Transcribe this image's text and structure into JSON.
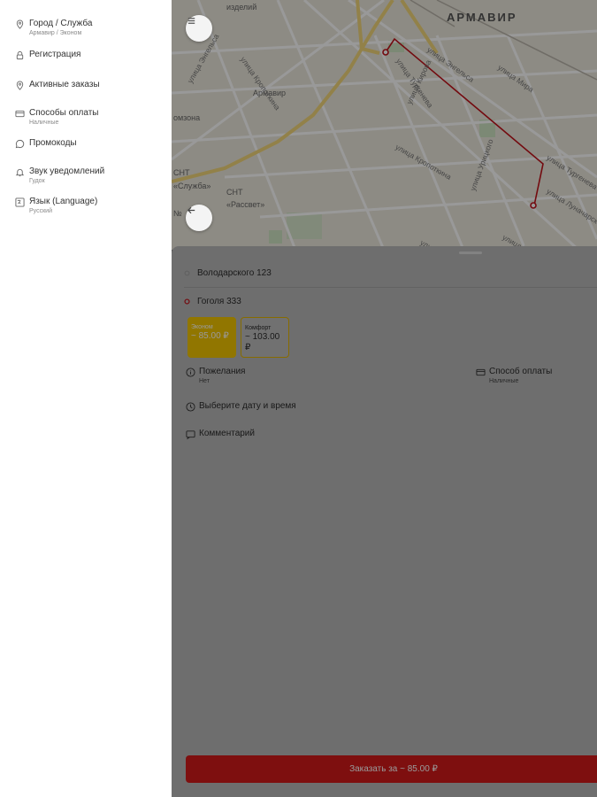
{
  "drawer": {
    "items": [
      {
        "label": "Город / Служба",
        "sub": "Армавир / Эконом",
        "icon": "location-pin-icon"
      },
      {
        "label": "Регистрация",
        "sub": "",
        "icon": "lock-icon"
      },
      {
        "label": "Активные заказы",
        "sub": "",
        "icon": "location-pin-icon"
      },
      {
        "label": "Способы оплаты",
        "sub": "Наличные",
        "icon": "card-icon"
      },
      {
        "label": "Промокоды",
        "sub": "",
        "icon": "chat-bubble-icon"
      },
      {
        "label": "Звук уведомлений",
        "sub": "Гудок",
        "icon": "bell-icon"
      },
      {
        "label": "Язык (Language)",
        "sub": "Русский",
        "icon": "translate-icon"
      }
    ]
  },
  "map": {
    "city": "АРМАВИР",
    "labels": [
      "изделий",
      "Армавир",
      "омзона",
      "СНТ",
      "«Рассвет»",
      "СНТ",
      "«Служба»",
      "№"
    ],
    "streets": [
      "улица Тургенева",
      "улица Энгельса",
      "улица Мира",
      "улица Кирова",
      "улица Кропоткина",
      "улица Урицкого",
      "улица Тургенева",
      "улица Луначарского",
      "улица Кропоткина",
      "улица Урицкого",
      "улица Кропоткина",
      "улица Энгельса"
    ],
    "route_color": "#c0121a"
  },
  "sheet": {
    "from": "Володарского 123",
    "to": "Гоголя 333",
    "tariffs": [
      {
        "name": "Эконом",
        "price": "~ 85.00 ₽"
      },
      {
        "name": "Комфорт",
        "price": "~ 103.00 ₽"
      }
    ],
    "wishes": {
      "label": "Пожелания",
      "sub": "Нет"
    },
    "payment": {
      "label": "Способ оплаты",
      "sub": "Наличные"
    },
    "datetime": {
      "label": "Выберите дату и время"
    },
    "comment": {
      "label": "Комментарий"
    },
    "order_button": "Заказать за ~ 85.00 ₽"
  },
  "colors": {
    "accent_yellow": "#f2c500",
    "order_red": "#d21a1a"
  }
}
